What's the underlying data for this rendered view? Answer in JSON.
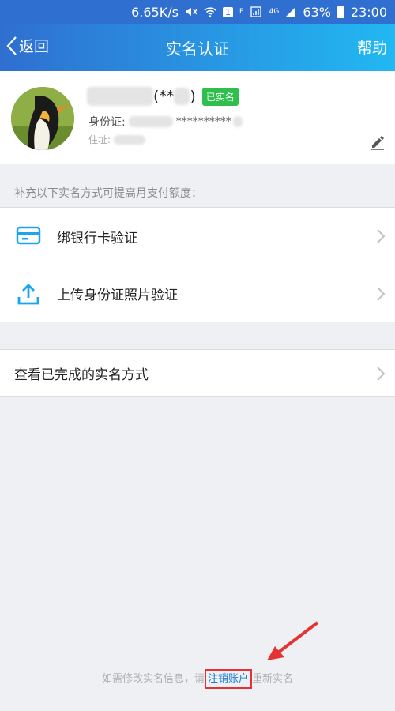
{
  "statusbar": {
    "speed": "6.65K/s",
    "sim_label": "1",
    "e_label": "E",
    "net_label": "4G",
    "battery": "63%",
    "time": "23:00"
  },
  "navbar": {
    "back_label": "返回",
    "title": "实名认证",
    "help_label": "帮助"
  },
  "profile": {
    "name_suffix": "(**",
    "name_close": ")",
    "verified_badge": "已实名",
    "id_label": "身份证:",
    "id_masked": "**********",
    "address_label": "住址:"
  },
  "hint": "补充以下实名方式可提高月支付额度：",
  "methods": [
    {
      "label": "绑银行卡验证",
      "icon": "bank-card-icon"
    },
    {
      "label": "上传身份证照片验证",
      "icon": "upload-icon"
    }
  ],
  "completed": {
    "label": "查看已完成的实名方式"
  },
  "footer": {
    "prefix": "如需修改实名信息，请",
    "link": "注销账户",
    "suffix": "重新实名"
  },
  "colors": {
    "nav_start": "#2f6fd0",
    "nav_end": "#22b8f2",
    "badge": "#2ebf4c",
    "link": "#1e7fd6",
    "annotation": "#e53232"
  }
}
